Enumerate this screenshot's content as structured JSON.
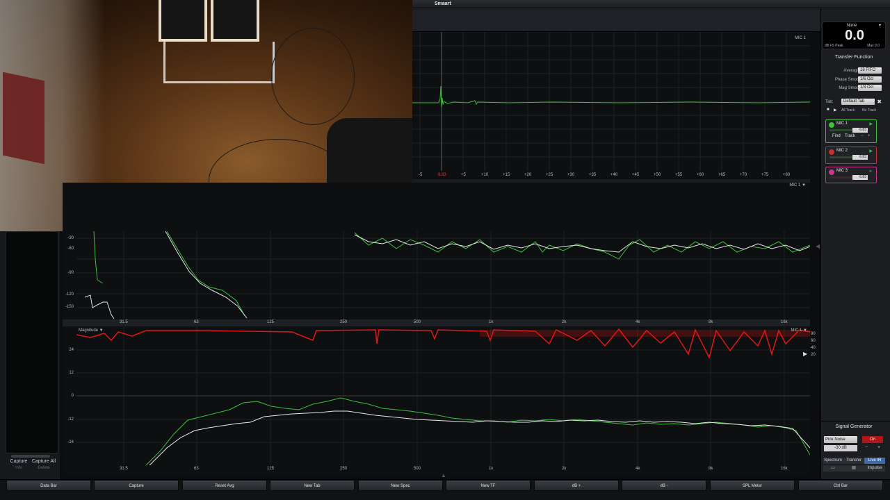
{
  "titlebar": {
    "app_title": "Smaart"
  },
  "impulse_plot": {
    "label": "MIC 1",
    "x_ticks": [
      "-5",
      "6.83",
      "+5",
      "+10",
      "+15",
      "+20",
      "+25",
      "+30",
      "+35",
      "+40",
      "+45",
      "+50",
      "+55",
      "+60",
      "+65",
      "+70",
      "+75",
      "+80"
    ]
  },
  "phase_plot": {
    "label": "MIC 1 ▼",
    "y_ticks": [
      "-30",
      "-60",
      "-90",
      "-120",
      "-150"
    ],
    "x_ticks": [
      "31.5",
      "63",
      "125",
      "250",
      "500",
      "1k",
      "2k",
      "4k",
      "8k",
      "16k"
    ]
  },
  "magnitude_plot": {
    "label": "Magnitude ▼",
    "coherence_label": "MIC 1 ▼",
    "y_ticks": [
      "24",
      "12",
      "0",
      "-12",
      "-24"
    ],
    "coherence_ticks": [
      "80",
      "60",
      "40",
      "20"
    ],
    "x_ticks": [
      "31.5",
      "63",
      "125",
      "250",
      "500",
      "1k",
      "2k",
      "4k",
      "8k",
      "16k"
    ]
  },
  "meter": {
    "source": "None",
    "value": "0.0",
    "unit": "dB FS Peak",
    "max": "Max 0.0"
  },
  "transfer_function": {
    "title": "Transfer Function",
    "averaging_label": "Averaging:",
    "averaging_value": "16 FIFO",
    "phase_smooth_label": "Phase Smooth:",
    "phase_smooth_value": "1/6 Oct",
    "mag_smooth_label": "Mag Smooth:",
    "mag_smooth_value": "1/3 Oct",
    "tab_label": "Tab:",
    "tab_value": "Default Tab",
    "all_track": "All Track",
    "no_track": "No Track"
  },
  "mics": [
    {
      "name": "MIC 1",
      "delay": "6.83",
      "color": "#3fbf3f",
      "find": "Find",
      "track": "Track"
    },
    {
      "name": "MIC 2",
      "delay": "6.83",
      "color": "#c83030"
    },
    {
      "name": "MIC 3",
      "delay": "6.83",
      "color": "#c83a8a"
    }
  ],
  "signal_generator": {
    "title": "Signal Generator",
    "type": "Pink Noise",
    "state": "On",
    "level": "-30 dB"
  },
  "modes": {
    "spectrum": "Spectrum",
    "transfer": "Transfer",
    "live_ir": "Live IR",
    "impulse": "Impulse"
  },
  "left_panel": {
    "capture": "Capture",
    "capture_all": "Capture All",
    "info": "Info",
    "delete": "Delete"
  },
  "bottom_buttons": [
    "Data Bar",
    "Capture",
    "Reset Avg",
    "New Tab",
    "New Spec",
    "New TF",
    "dB +",
    "dB -",
    "SPL Meter",
    "Ctrl Bar"
  ],
  "colors": {
    "trace_live": "#3fbf3f",
    "trace_ref": "#e8e8e8",
    "coherence": "#e01818",
    "accent_on": "#b01616"
  }
}
